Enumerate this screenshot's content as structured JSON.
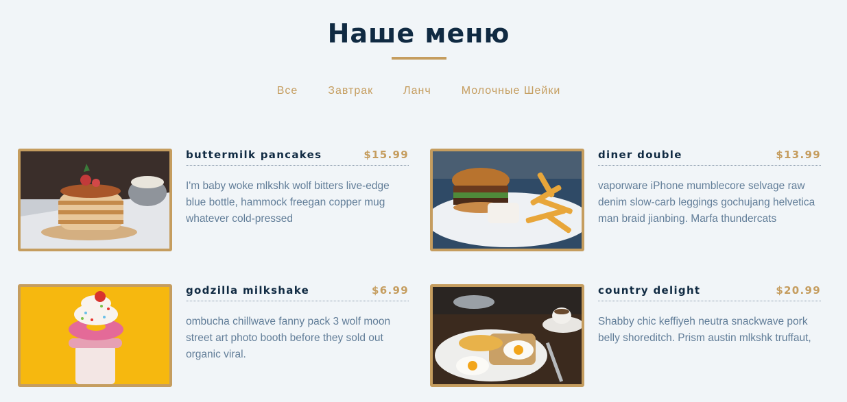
{
  "title": "Наше меню",
  "filters": [
    "Все",
    "Завтрак",
    "Ланч",
    "Молочные Шейки"
  ],
  "items": [
    {
      "name": "buttermilk pancakes",
      "price": "$15.99",
      "desc": "I'm baby woke mlkshk wolf bitters live-edge blue bottle, hammock freegan copper mug whatever cold-pressed",
      "image": "pancakes-photo"
    },
    {
      "name": "diner double",
      "price": "$13.99",
      "desc": "vaporware iPhone mumblecore selvage raw denim slow-carb leggings gochujang helvetica man braid jianbing. Marfa thundercats",
      "image": "burger-photo"
    },
    {
      "name": "godzilla milkshake",
      "price": "$6.99",
      "desc": "ombucha chillwave fanny pack 3 wolf moon street art photo booth before they sold out organic viral.",
      "image": "milkshake-photo"
    },
    {
      "name": "country delight",
      "price": "$20.99",
      "desc": "Shabby chic keffiyeh neutra snackwave pork belly shoreditch. Prism austin mlkshk truffaut,",
      "image": "breakfast-photo"
    }
  ],
  "colors": {
    "accent": "#c59d5f",
    "heading": "#102a42",
    "text": "#617d98",
    "background": "#f1f5f8"
  }
}
